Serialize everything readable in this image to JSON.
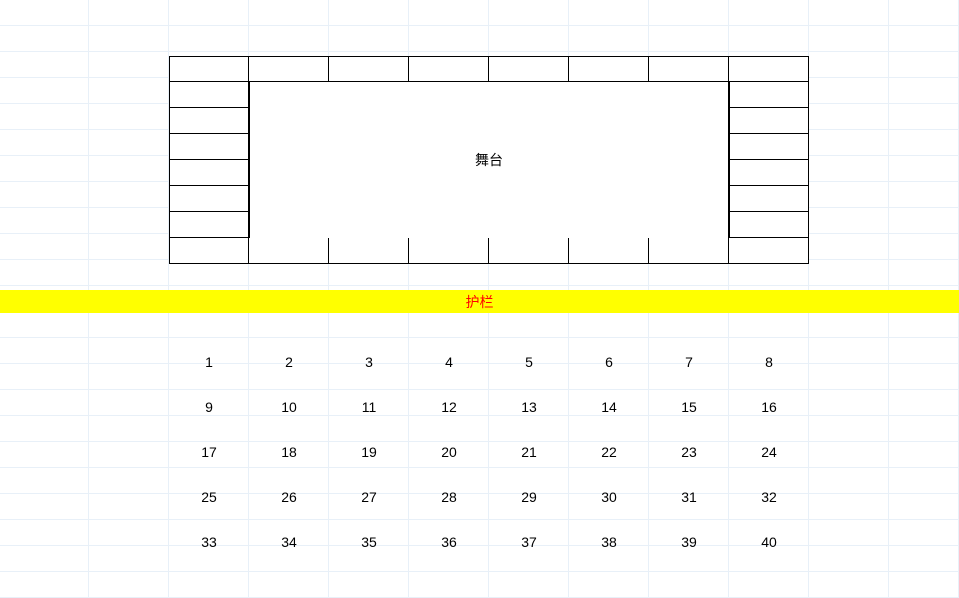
{
  "stage": {
    "label": "舞台"
  },
  "barrier": {
    "label": "护栏"
  },
  "seats": {
    "rows": [
      [
        1,
        2,
        3,
        4,
        5,
        6,
        7,
        8
      ],
      [
        9,
        10,
        11,
        12,
        13,
        14,
        15,
        16
      ],
      [
        17,
        18,
        19,
        20,
        21,
        22,
        23,
        24
      ],
      [
        25,
        26,
        27,
        28,
        29,
        30,
        31,
        32
      ],
      [
        33,
        34,
        35,
        36,
        37,
        38,
        39,
        40
      ]
    ]
  }
}
